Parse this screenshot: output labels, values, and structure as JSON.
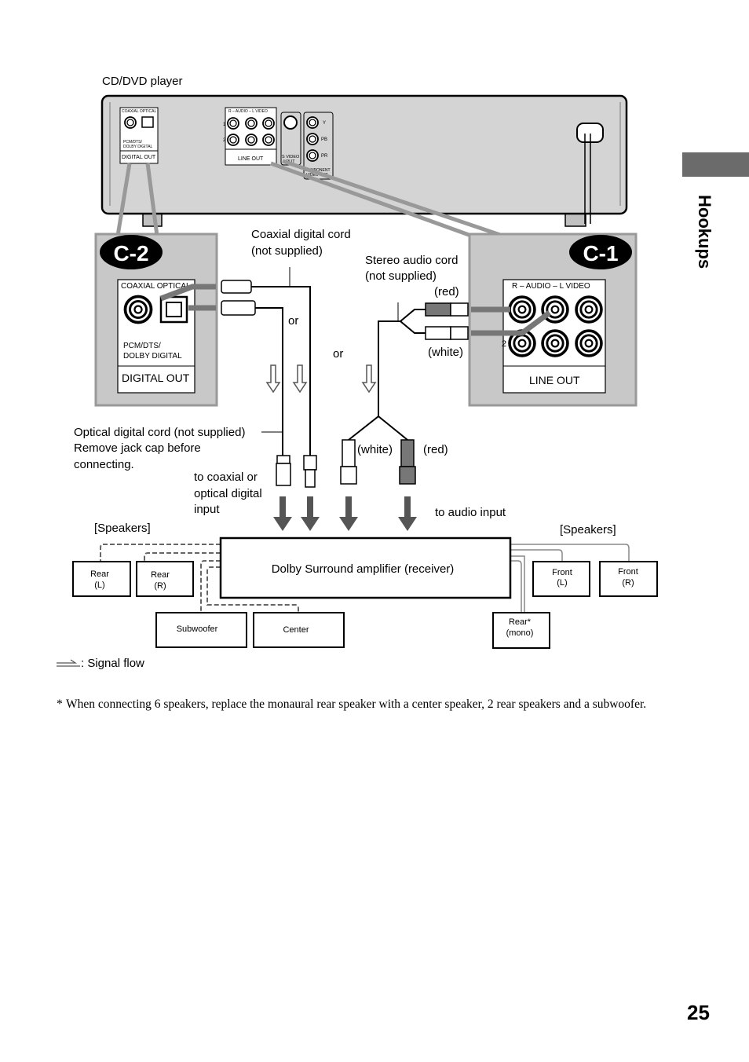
{
  "side_tab": {
    "label": "Hookups",
    "color": "#6b6b6b"
  },
  "page_number": "25",
  "player": {
    "label": "CD/DVD player",
    "digital_header": "COAXIAL  OPTICAL",
    "digital_sub1": "PCM/DTS/",
    "digital_sub2": "DOLBY DIGITAL",
    "digital_out": "DIGITAL OUT",
    "line_header": "R – AUDIO – L      VIDEO",
    "line_out": "LINE OUT",
    "svideo1": "S VIDEO",
    "svideo2": "OUT",
    "component_y": "Y",
    "component_pb": "PB",
    "component_pr": "PR",
    "component1": "COMPONENT",
    "component2": "VIDEO OUT",
    "row1": "1",
    "row2": "2"
  },
  "c2": {
    "badge": "C-2",
    "header": "COAXIAL  OPTICAL",
    "sub1": "PCM/DTS/",
    "sub2": "DOLBY DIGITAL",
    "label": "DIGITAL OUT"
  },
  "c1": {
    "badge": "C-1",
    "header": "R – AUDIO – L       VIDEO",
    "row2": "2",
    "label": "LINE OUT"
  },
  "labels": {
    "coax_cord1": "Coaxial digital cord",
    "coax_cord2": "(not supplied)",
    "stereo_cord1": "Stereo audio cord",
    "stereo_cord2": "(not supplied)",
    "red_top": "(red)",
    "white_top": "(white)",
    "or1": "or",
    "or2": "or",
    "optical1": "Optical digital cord (not supplied)",
    "optical2": "Remove jack cap before",
    "optical3": "connecting.",
    "to_coax1": "to coaxial or",
    "to_coax2": "optical digital",
    "to_coax3": "input",
    "white_bottom": "(white)",
    "red_bottom": "(red)",
    "to_audio": "to audio input",
    "speakers_left": "[Speakers]",
    "speakers_right": "[Speakers]",
    "amplifier": "Dolby Surround amplifier (receiver)",
    "signal_flow": ": Signal flow"
  },
  "speakers": [
    {
      "l1": "Rear",
      "l2": "(L)"
    },
    {
      "l1": "Rear",
      "l2": "(R)"
    },
    {
      "l1": "Subwoofer",
      "l2": ""
    },
    {
      "l1": "Center",
      "l2": ""
    },
    {
      "l1": "Front",
      "l2": "(L)"
    },
    {
      "l1": "Front",
      "l2": "(R)"
    },
    {
      "l1": "Rear*",
      "l2": "(mono)"
    }
  ],
  "footnote": {
    "marker": "*",
    "text": "When connecting 6 speakers, replace the monaural rear speaker with a center speaker, 2 rear speakers and a subwoofer."
  },
  "colors": {
    "panel_gray": "#c8c8c8",
    "body_gray": "#d4d4d4",
    "badge": "#000000"
  }
}
